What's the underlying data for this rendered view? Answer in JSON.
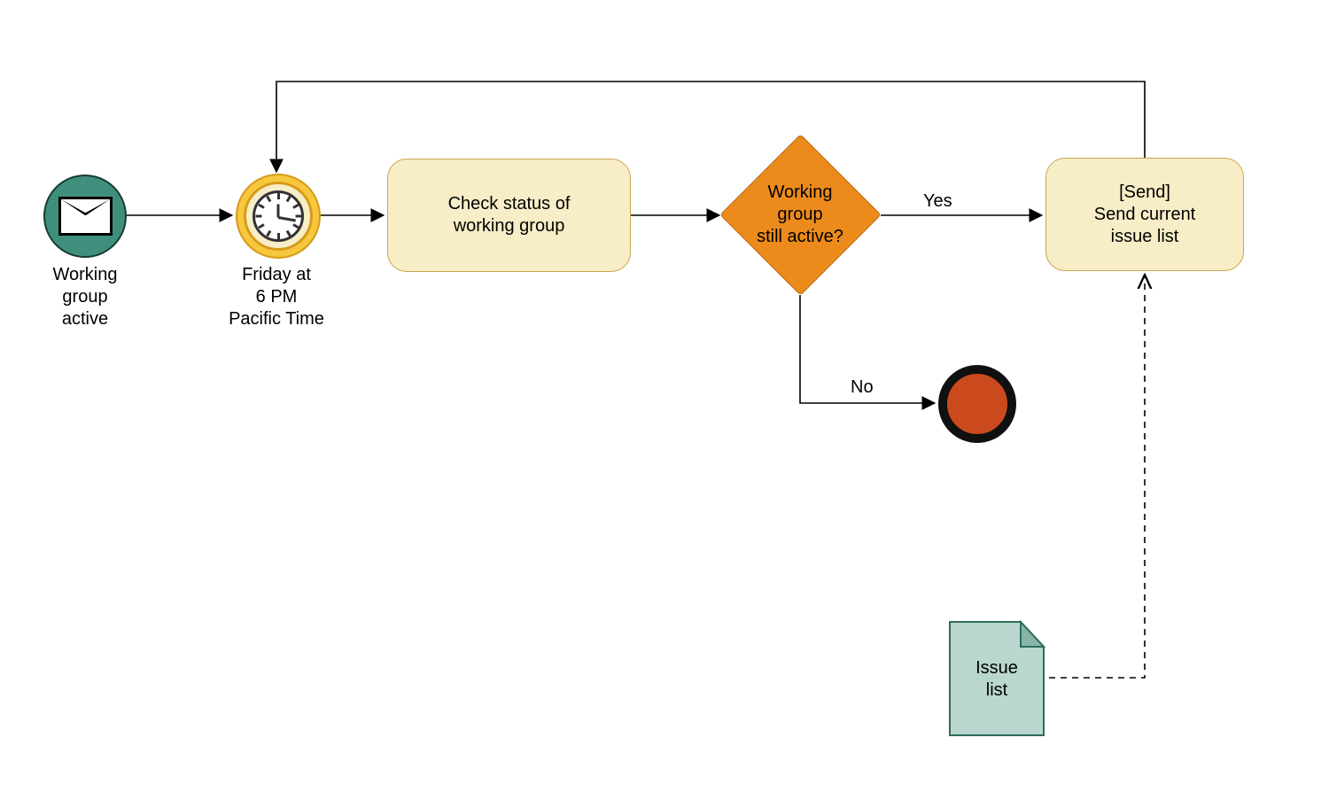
{
  "start_event": {
    "label": "Working\ngroup\nactive"
  },
  "timer_event": {
    "label": "Friday at\n6 PM\nPacific Time"
  },
  "task_check": {
    "label": "Check status of\nworking group"
  },
  "gateway": {
    "label": "Working\ngroup\nstill active?"
  },
  "edge_yes": {
    "label": "Yes"
  },
  "edge_no": {
    "label": "No"
  },
  "task_send": {
    "label": "[Send]\nSend current\nissue list"
  },
  "data_object": {
    "label": "Issue\nlist"
  }
}
